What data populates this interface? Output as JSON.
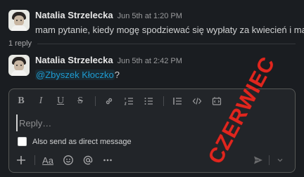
{
  "messages": [
    {
      "author": "Natalia Strzelecka",
      "time": "Jun 5th at 1:20 PM",
      "text": "mam pytanie, kiedy mogę spodziewać się wypłaty za kwiecień i maj?"
    },
    {
      "author": "Natalia Strzelecka",
      "time": "Jun 5th at 2:42 PM",
      "mention": "@Zbyszek Kłoczko",
      "text_suffix": "?"
    }
  ],
  "thread": {
    "reply_count": "1 reply"
  },
  "composer": {
    "placeholder": "Reply…",
    "dm_checkbox_label": "Also send as direct message",
    "dm_checked": false,
    "toolbar_icons": [
      "bold-icon",
      "italic-icon",
      "underline-icon",
      "strikethrough-icon",
      "link-icon",
      "ordered-list-icon",
      "bulleted-list-icon",
      "blockquote-icon",
      "code-icon",
      "code-block-icon"
    ],
    "bottom_icons": [
      "plus-icon",
      "text-format-icon",
      "emoji-icon",
      "mention-icon",
      "more-icon",
      "send-icon",
      "chevron-down-icon"
    ],
    "bold_glyph": "B",
    "italic_glyph": "I",
    "underline_glyph": "U",
    "strike_glyph": "S",
    "format_glyph": "Aa"
  },
  "stamp": {
    "text": "CZERWIEC",
    "color": "#e0261e"
  },
  "colors": {
    "background": "#1a1d21",
    "mention": "#1d9bd1"
  }
}
